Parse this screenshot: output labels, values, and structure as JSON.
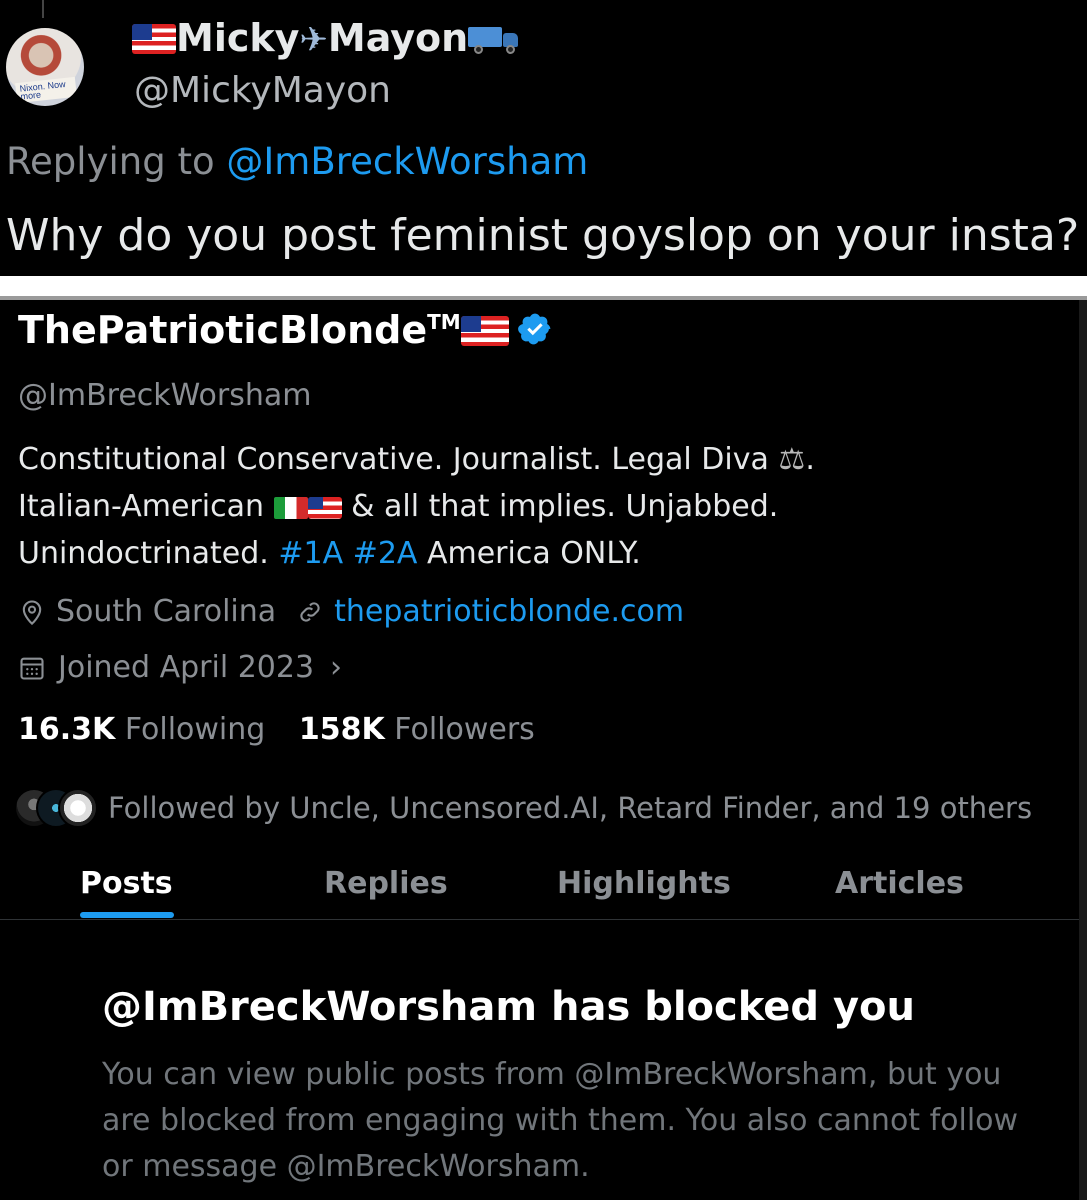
{
  "reply_tweet": {
    "display_name_part1": "Micky",
    "display_name_part2": "Mayon",
    "handle": "@MickyMayon",
    "avatar_sign_text": "Nixon. Now more",
    "replying_prefix": "Replying to ",
    "replying_to": "@ImBreckWorsham",
    "text": "Why do you post feminist goyslop on your insta?"
  },
  "profile": {
    "display_name": "ThePatrioticBlonde",
    "trademark": "TM",
    "verified": true,
    "handle": "@ImBreckWorsham",
    "bio": {
      "line1": "Constitutional Conservative. Journalist. Legal Diva ",
      "line1_end": ".",
      "line2_start": "Italian-American ",
      "line2_end": " & all that implies. Unjabbed.",
      "line3_start": "Unindoctrinated. ",
      "hashtag1": "#1A",
      "hashtag2": "#2A",
      "line3_end": " America ONLY."
    },
    "location": "South Carolina",
    "website": "thepatrioticblonde.com",
    "joined": "Joined April 2023",
    "following_count": "16.3K",
    "following_label": "Following",
    "followers_count": "158K",
    "followers_label": "Followers",
    "followed_by": "Followed by Uncle, Uncensored.AI, Retard Finder, and 19 others"
  },
  "tabs": [
    {
      "label": "Posts",
      "active": true
    },
    {
      "label": "Replies",
      "active": false
    },
    {
      "label": "Highlights",
      "active": false
    },
    {
      "label": "Articles",
      "active": false
    }
  ],
  "blocked_notice": {
    "title": "@ImBreckWorsham has blocked you",
    "body": "You can view public posts from @ImBreckWorsham, but you are blocked from engaging with them. You also cannot follow or message @ImBreckWorsham."
  },
  "colors": {
    "accent": "#1d9bf0",
    "background": "#000000",
    "secondary_text": "#8b8f94"
  },
  "icons": [
    "us-flag-icon",
    "airplane-icon",
    "truck-icon",
    "verified-badge-icon",
    "scales-icon",
    "italy-flag-icon",
    "location-pin-icon",
    "link-icon",
    "calendar-icon",
    "chevron-right-icon"
  ]
}
